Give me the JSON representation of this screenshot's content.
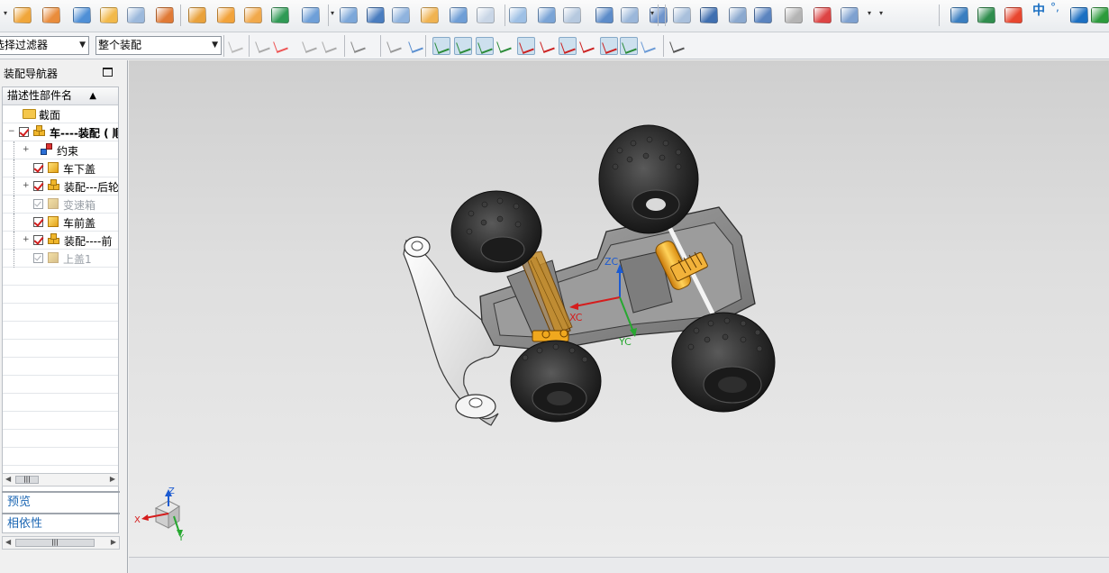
{
  "toolbar": {
    "row1_icons": [
      "block-icon",
      "cylinder-icon",
      "sphere-icon",
      "extrude-icon",
      "revolve-icon",
      "shell-icon",
      "hole-icon",
      "pattern-icon",
      "array-icon",
      "union-icon",
      "boolean-icon",
      "blend-icon",
      "chamfer-icon",
      "draft-icon",
      "offset-icon",
      "trim-icon",
      "split-icon",
      "thicken-icon",
      "sew-icon",
      "patch-icon",
      "replace-icon",
      "mirror-icon",
      "move-face-icon",
      "surface-icon",
      "mesh-icon",
      "through-curves-icon",
      "swept-icon",
      "styled-icon",
      "law-icon",
      "flange-icon",
      "layer-settings-icon",
      "layers-icon",
      "ime-logo-icon",
      "smiley-icon",
      "checkmark-icon"
    ],
    "ime_label": "中",
    "ime_punct": "°,"
  },
  "selection_bar": {
    "filter_value": "选择过滤器",
    "scope_value": "整个装配",
    "snap_icons": [
      "end-point-icon",
      "mid-point-icon",
      "control-point-icon",
      "intersection-icon",
      "arc-center-icon",
      "quadrant-icon",
      "existing-point-icon",
      "point-on-curve-icon",
      "point-on-face-icon",
      "grid-icon"
    ]
  },
  "navigator": {
    "title": "装配导航器",
    "column_header": "描述性部件名",
    "sort_glyph": "▲",
    "items": [
      {
        "label": "截面",
        "type": "folder",
        "indent": 0,
        "expand": "",
        "check": "",
        "style": ""
      },
      {
        "label": "车----装配 ( 顺",
        "type": "assembly",
        "indent": 0,
        "expand": "−",
        "check": "on",
        "style": "bold"
      },
      {
        "label": "约束",
        "type": "constraint",
        "indent": 1,
        "expand": "+",
        "check": "",
        "style": ""
      },
      {
        "label": "车下盖",
        "type": "part",
        "indent": 1,
        "expand": "",
        "check": "on",
        "style": ""
      },
      {
        "label": "装配---后轮",
        "type": "assembly",
        "indent": 1,
        "expand": "+",
        "check": "on",
        "style": ""
      },
      {
        "label": "变速箱",
        "type": "part",
        "indent": 1,
        "expand": "",
        "check": "off",
        "style": "gray"
      },
      {
        "label": "车前盖",
        "type": "part",
        "indent": 1,
        "expand": "",
        "check": "on",
        "style": ""
      },
      {
        "label": "装配----前",
        "type": "assembly",
        "indent": 1,
        "expand": "+",
        "check": "on",
        "style": ""
      },
      {
        "label": "上盖1",
        "type": "part",
        "indent": 1,
        "expand": "",
        "check": "off",
        "style": "gray"
      }
    ],
    "scroll_thumb": "|||",
    "preview_label": "预览",
    "dependency_label": "相依性"
  },
  "viewport": {
    "wcs": {
      "x": "XC",
      "y": "YC",
      "z": "ZC"
    },
    "triad": {
      "x": "X",
      "y": "Y",
      "z": "Z"
    }
  },
  "colors": {
    "tire": "#2b2b2b",
    "chassis": "#8d8d8d",
    "gear": "#f3a81c",
    "arm": "#f2f2f2",
    "accent_blue": "#1b66b3"
  }
}
